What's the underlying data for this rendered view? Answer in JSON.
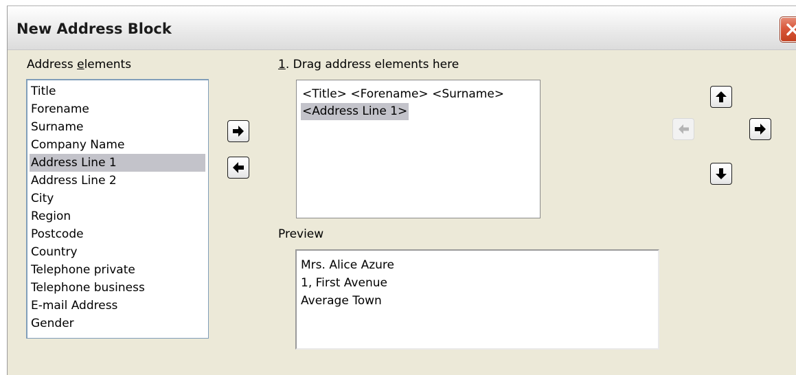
{
  "window": {
    "title": "New Address Block"
  },
  "address_elements": {
    "label_prefix": "Address ",
    "label_mnemonic": "e",
    "label_suffix": "lements",
    "items": [
      "Title",
      "Forename",
      "Surname",
      "Company Name",
      "Address Line 1",
      "Address Line 2",
      "City",
      "Region",
      "Postcode",
      "Country",
      "Telephone private",
      "Telephone business",
      "E-mail Address",
      "Gender"
    ],
    "selected": "Address Line 1"
  },
  "drag_area": {
    "label_mnemonic": "1",
    "label_suffix": ". Drag address elements here",
    "lines": [
      "<Title> <Forename> <Surname>",
      "<Address Line 1>"
    ],
    "selected_line": "<Address Line 1>"
  },
  "preview": {
    "label": "Preview",
    "lines": [
      "Mrs. Alice Azure",
      "1, First Avenue",
      "Average Town"
    ]
  },
  "icons": {
    "add": "arrow-right-icon",
    "remove": "arrow-left-icon",
    "move_up": "arrow-up-icon",
    "move_down": "arrow-down-icon",
    "move_left": "arrow-left-icon",
    "move_right": "arrow-right-icon",
    "close": "close-icon"
  },
  "colors": {
    "dialog_background": "#ece9d8",
    "selection": "#c3c3ca",
    "close_button": "#d9583b"
  }
}
